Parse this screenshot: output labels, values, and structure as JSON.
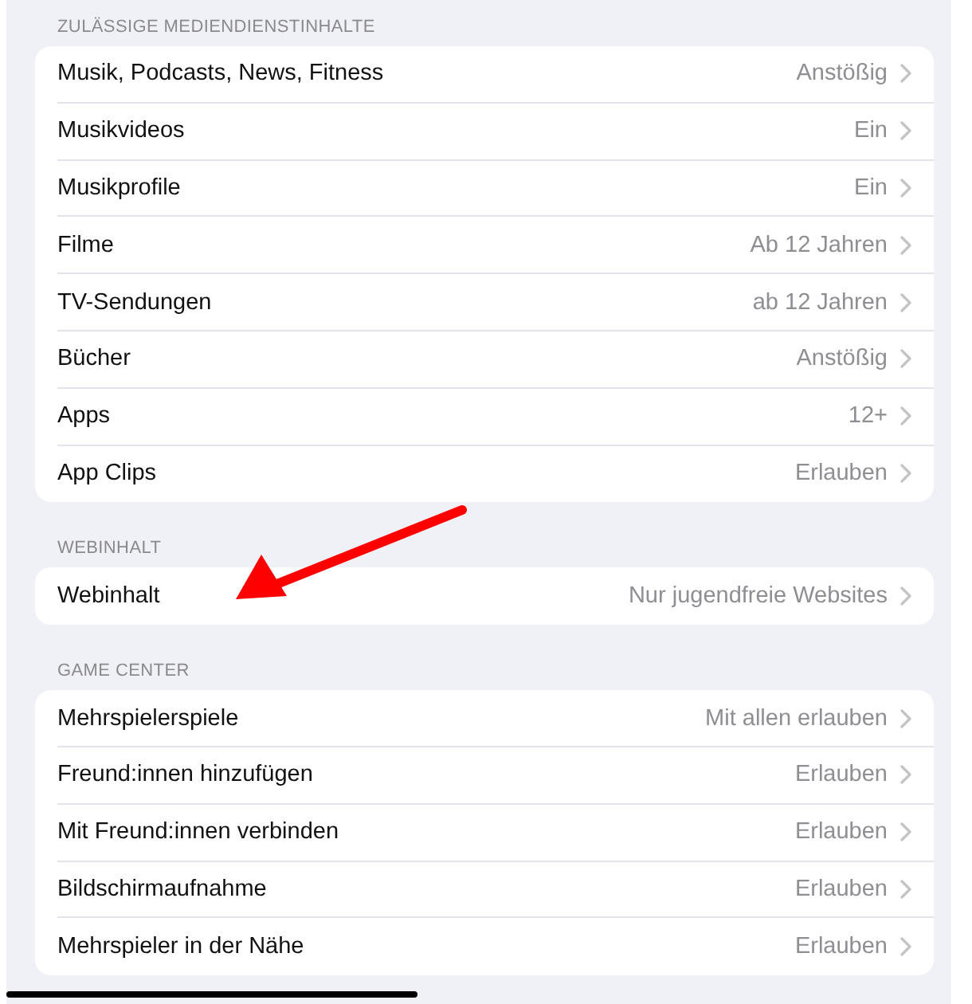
{
  "sections": [
    {
      "header": "ZULÄSSIGE MEDIENDIENSTINHALTE",
      "rows": [
        {
          "label": "Musik, Podcasts, News, Fitness",
          "value": "Anstößig"
        },
        {
          "label": "Musikvideos",
          "value": "Ein"
        },
        {
          "label": "Musikprofile",
          "value": "Ein"
        },
        {
          "label": "Filme",
          "value": "Ab 12 Jahren"
        },
        {
          "label": "TV-Sendungen",
          "value": "ab 12 Jahren"
        },
        {
          "label": "Bücher",
          "value": "Anstößig"
        },
        {
          "label": "Apps",
          "value": "12+"
        },
        {
          "label": "App Clips",
          "value": "Erlauben"
        }
      ]
    },
    {
      "header": "WEBINHALT",
      "rows": [
        {
          "label": "Webinhalt",
          "value": "Nur jugendfreie Websites"
        }
      ]
    },
    {
      "header": "GAME CENTER",
      "rows": [
        {
          "label": "Mehrspielerspiele",
          "value": "Mit allen erlauben"
        },
        {
          "label": "Freund:innen hinzufügen",
          "value": "Erlauben"
        },
        {
          "label": "Mit Freund:innen verbinden",
          "value": "Erlauben"
        },
        {
          "label": "Bildschirmaufnahme",
          "value": "Erlauben"
        },
        {
          "label": "Mehrspieler in der Nähe",
          "value": "Erlauben"
        }
      ]
    }
  ]
}
